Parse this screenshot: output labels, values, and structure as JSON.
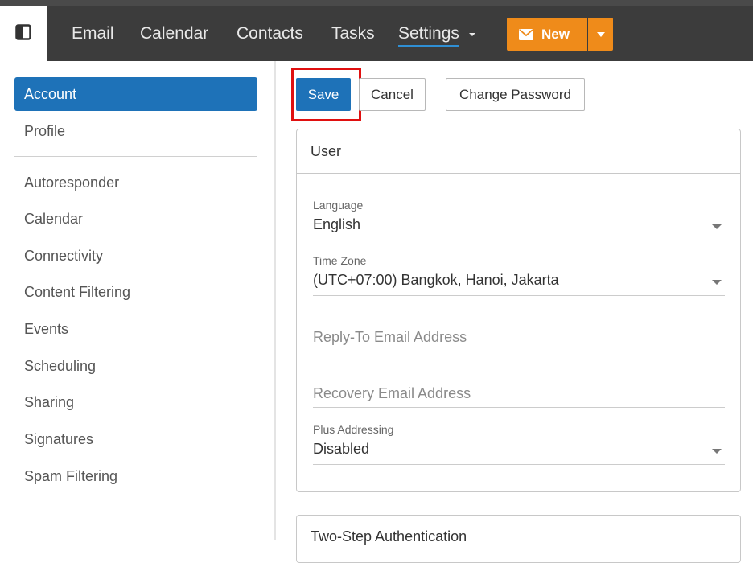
{
  "nav": {
    "items": [
      "Email",
      "Calendar",
      "Contacts",
      "Tasks",
      "Settings"
    ],
    "active": "Settings",
    "new_label": "New",
    "accent_color": "#ef8b1a",
    "icons": {
      "sidebar_toggle": "sidebar-toggle-icon",
      "new": "envelope-icon",
      "new_dropdown": "caret-down-icon"
    }
  },
  "sidebar": {
    "active_color": "#1e72b8",
    "primary": [
      "Account",
      "Profile"
    ],
    "items": [
      "Autoresponder",
      "Calendar",
      "Connectivity",
      "Content Filtering",
      "Events",
      "Scheduling",
      "Sharing",
      "Signatures",
      "Spam Filtering"
    ]
  },
  "toolbar": {
    "save_label": "Save",
    "cancel_label": "Cancel",
    "change_password_label": "Change Password",
    "highlight_color": "#e01010"
  },
  "user_card": {
    "title": "User",
    "language": {
      "label": "Language",
      "value": "English"
    },
    "time_zone": {
      "label": "Time Zone",
      "value": "(UTC+07:00) Bangkok, Hanoi, Jakarta"
    },
    "reply_to": {
      "placeholder": "Reply-To Email Address"
    },
    "recovery": {
      "placeholder": "Recovery Email Address"
    },
    "plus_addressing": {
      "label": "Plus Addressing",
      "value": "Disabled"
    }
  },
  "two_step_card": {
    "title": "Two-Step Authentication"
  }
}
